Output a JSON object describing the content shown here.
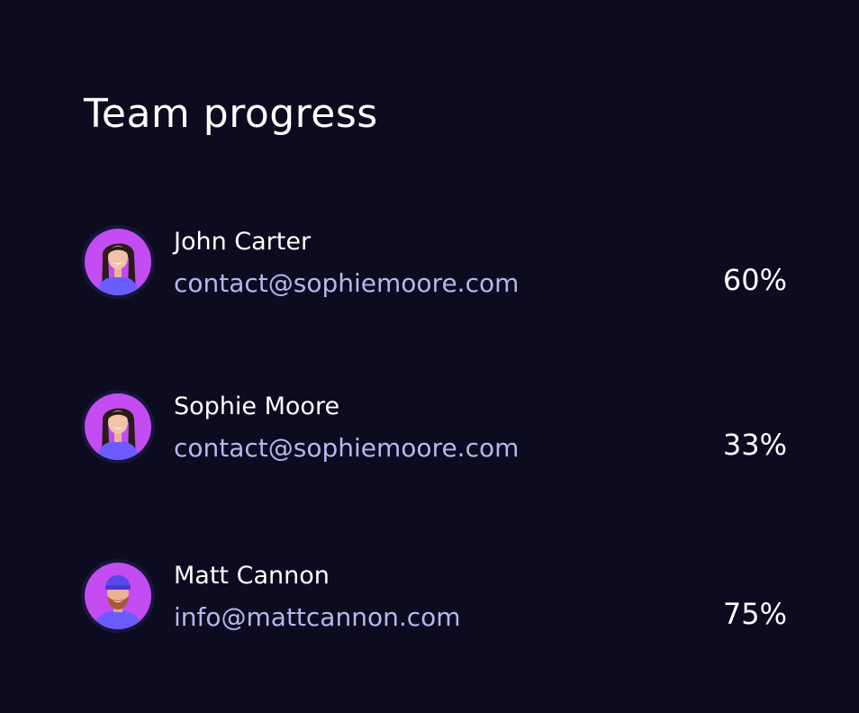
{
  "header": {
    "title": "Team progress"
  },
  "members": [
    {
      "name": "John Carter",
      "email": "contact@sophiemoore.com",
      "progress": "60%",
      "avatar": "woman-long-hair"
    },
    {
      "name": "Sophie Moore",
      "email": "contact@sophiemoore.com",
      "progress": "33%",
      "avatar": "woman-long-hair"
    },
    {
      "name": "Matt Cannon",
      "email": "info@mattcannon.com",
      "progress": "75%",
      "avatar": "man-beanie"
    }
  ],
  "colors": {
    "background": "#0c0b1f",
    "avatar_bg": "#c34cf2",
    "avatar_ring": "#16163a",
    "email_text": "#b8b6ec",
    "shirt": "#6b5cff"
  }
}
